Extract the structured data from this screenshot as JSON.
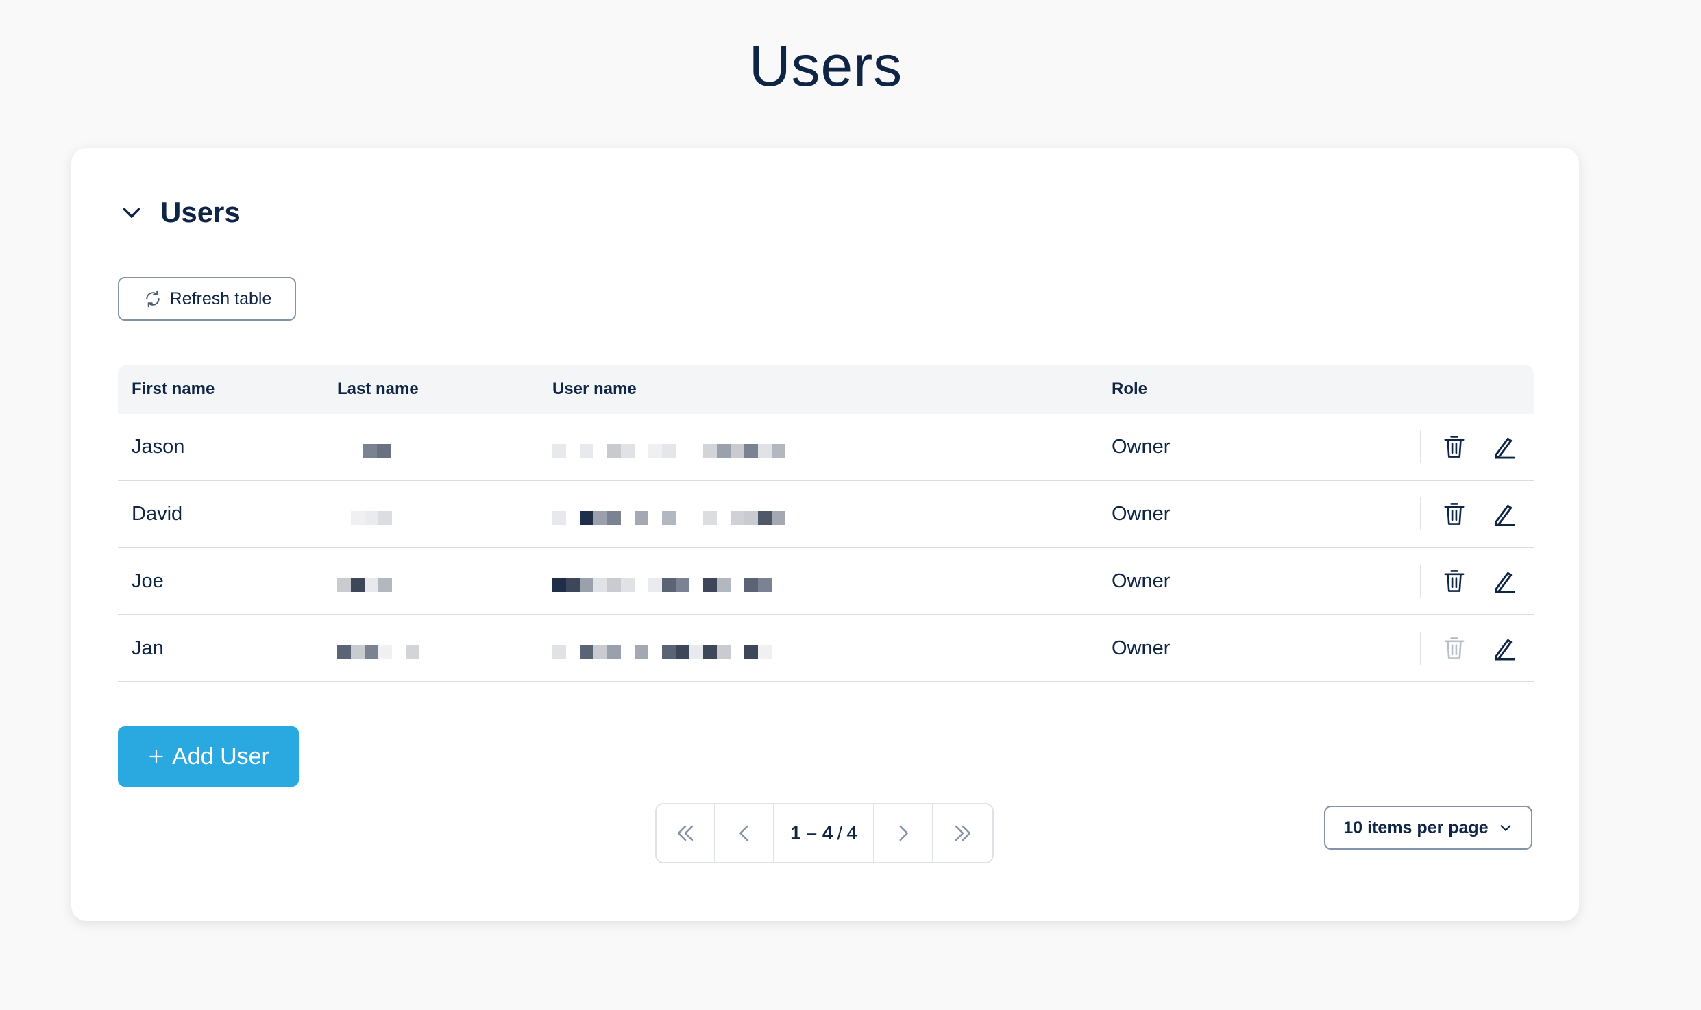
{
  "page": {
    "title": "Users"
  },
  "section": {
    "title": "Users",
    "toggle_icon": "chevron-down-icon"
  },
  "toolbar": {
    "refresh_label": "Refresh table",
    "refresh_icon": "refresh-icon"
  },
  "table": {
    "columns": [
      "First name",
      "Last name",
      "User name",
      "Role"
    ],
    "rows": [
      {
        "first_name": "Jason",
        "role": "Owner",
        "delete_enabled": true
      },
      {
        "first_name": "David",
        "role": "Owner",
        "delete_enabled": true
      },
      {
        "first_name": "Joe",
        "role": "Owner",
        "delete_enabled": true
      },
      {
        "first_name": "Jan",
        "role": "Owner",
        "delete_enabled": false
      }
    ]
  },
  "actions": {
    "add_user_label": "Add User",
    "add_icon": "plus-icon"
  },
  "pagination": {
    "range": "1 – 4",
    "total": "4",
    "separator": "/"
  },
  "page_size": {
    "label": "10 items per page"
  },
  "colors": {
    "primary": "#2aa8e0",
    "text": "#0f2545",
    "border": "#8593a6",
    "background": "#f9f9f9"
  }
}
